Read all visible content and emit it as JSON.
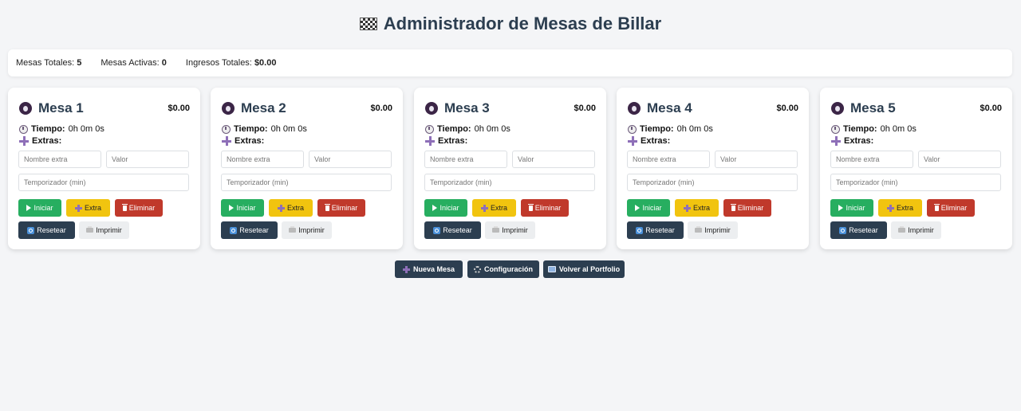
{
  "header": {
    "title": "Administrador de Mesas de Billar"
  },
  "stats": {
    "total_label": "Mesas Totales:",
    "total_value": "5",
    "active_label": "Mesas Activas:",
    "active_value": "0",
    "income_label": "Ingresos Totales:",
    "income_value": "$0.00"
  },
  "labels": {
    "time_label": "Tiempo:",
    "extras_label": "Extras:",
    "extra_name_placeholder": "Nombre extra",
    "extra_value_placeholder": "Valor",
    "timer_placeholder": "Temporizador (min)",
    "start": "Iniciar",
    "extra": "Extra",
    "delete": "Eliminar",
    "reset": "Resetear",
    "print": "Imprimir"
  },
  "tables": [
    {
      "name": "Mesa 1",
      "price": "$0.00",
      "time": "0h 0m 0s"
    },
    {
      "name": "Mesa 2",
      "price": "$0.00",
      "time": "0h 0m 0s"
    },
    {
      "name": "Mesa 3",
      "price": "$0.00",
      "time": "0h 0m 0s"
    },
    {
      "name": "Mesa 4",
      "price": "$0.00",
      "time": "0h 0m 0s"
    },
    {
      "name": "Mesa 5",
      "price": "$0.00",
      "time": "0h 0m 0s"
    }
  ],
  "footer": {
    "new_table": "Nueva Mesa",
    "settings": "Configuración",
    "back": "Volver al Portfolio"
  },
  "colors": {
    "green": "#27ae60",
    "yellow": "#f1c40f",
    "red": "#c0392b",
    "dark": "#2c3e50"
  }
}
